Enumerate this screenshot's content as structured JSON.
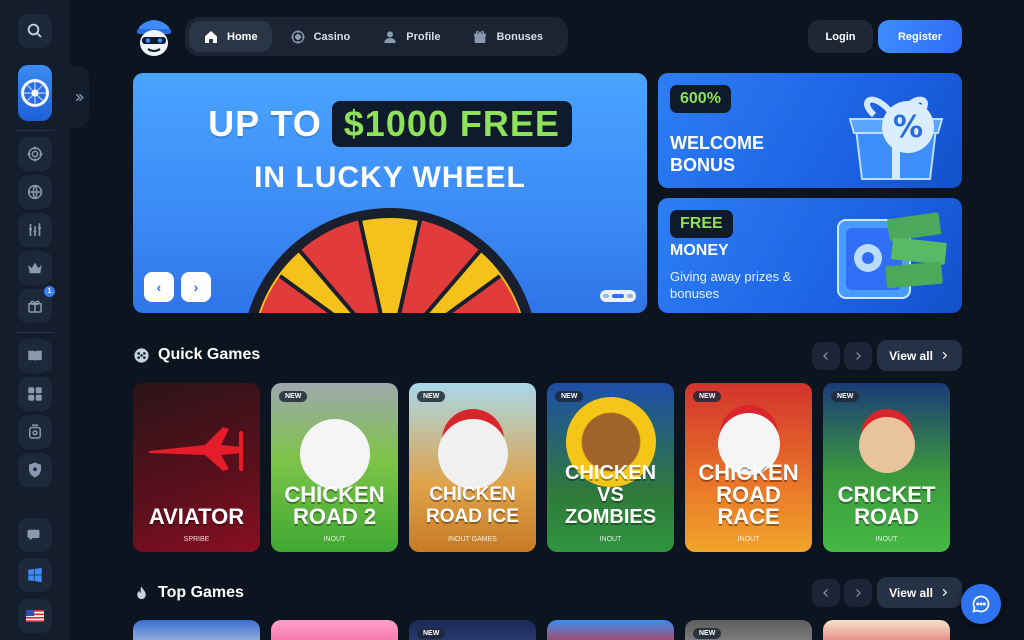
{
  "nav": {
    "items": [
      {
        "label": "Home",
        "icon": "home-icon",
        "active": true
      },
      {
        "label": "Casino",
        "icon": "casino-chip-icon"
      },
      {
        "label": "Profile",
        "icon": "user-icon"
      },
      {
        "label": "Bonuses",
        "icon": "gift-icon"
      }
    ]
  },
  "header": {
    "login_label": "Login",
    "register_label": "Register"
  },
  "sidebar": {
    "icons": [
      "search-icon",
      "lucky-wheel-icon",
      "casino-chip-icon",
      "globe-icon",
      "sports-icon",
      "crown-icon",
      "gift-icon",
      "book-icon",
      "games-icon",
      "vip-icon",
      "shield-icon",
      "chat-icon",
      "windows-icon",
      "us-flag-icon"
    ],
    "gift_badge": "1"
  },
  "hero": {
    "line1_prefix": "UP TO",
    "line1_highlight": "$1000 FREE",
    "line2": "IN LUCKY WHEEL",
    "prev_label": "‹",
    "next_label": "›"
  },
  "promos": [
    {
      "pill": "600%",
      "title_line1": "WELCOME",
      "title_line2": "BONUS"
    },
    {
      "pill": "FREE",
      "title_line1": "MONEY",
      "subtitle": "Giving away prizes & bonuses"
    }
  ],
  "quick_games": {
    "title": "Quick Games",
    "view_all": "View all",
    "games": [
      {
        "title": "AVIATOR",
        "provider": "SPRIBE",
        "new": false
      },
      {
        "title": "CHICKEN ROAD 2",
        "provider": "INOUT",
        "new": true,
        "badge": "NEW"
      },
      {
        "title": "CHICKEN ROAD ICE",
        "provider": "INOUT GAMES",
        "new": true,
        "badge": "NEW"
      },
      {
        "title": "CHICKEN VS ZOMBIES",
        "provider": "INOUT",
        "new": true,
        "badge": "NEW"
      },
      {
        "title": "CHICKEN ROAD RACE",
        "provider": "INOUT",
        "new": true,
        "badge": "NEW"
      },
      {
        "title": "CRICKET ROAD",
        "provider": "INOUT",
        "new": true,
        "badge": "NEW"
      }
    ]
  },
  "top_games": {
    "title": "Top Games",
    "view_all": "View all",
    "badge": "NEW"
  },
  "colors": {
    "accent": "#2f74ef",
    "highlight_green": "#8fe05a",
    "background": "#0c1420"
  }
}
